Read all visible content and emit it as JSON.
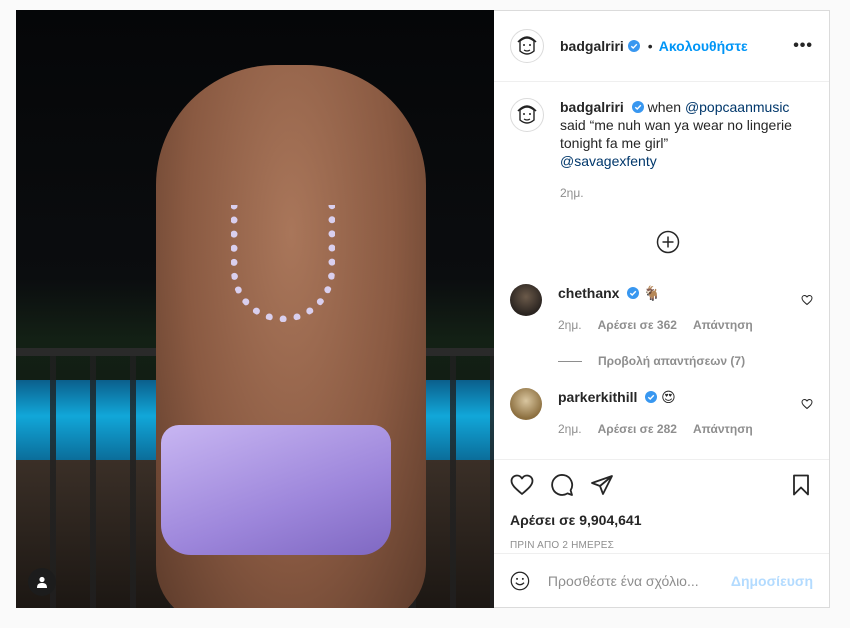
{
  "post": {
    "username": "badgalriri",
    "follow_label": "Ακολουθήστε",
    "dot": "•",
    "caption": {
      "prefix": "when ",
      "mention1": "@popcaanmusic",
      "text": " said “me nuh wan ya wear no lingerie tonight fa me girl”",
      "mention2": "@savagexfenty",
      "age": "2ημ."
    },
    "comments": [
      {
        "username": "chethanx",
        "emoji": "🐐",
        "age": "2ημ.",
        "likes": "Αρέσει σε 362",
        "reply": "Απάντηση",
        "view_replies": "Προβολή απαντήσεων (7)"
      },
      {
        "username": "parkerkithill",
        "emoji": "😍",
        "age": "2ημ.",
        "likes": "Αρέσει σε 282",
        "reply": "Απάντηση"
      }
    ],
    "likes_text": "Αρέσει σε 9,904,641",
    "timestamp": "ΠΡΙΝ ΑΠΟ 2 ΗΜΕΡΕΣ",
    "comment_placeholder": "Προσθέστε ένα σχόλιο...",
    "publish_label": "Δημοσίευση"
  },
  "icons": {
    "verified": "verified-badge-icon",
    "more": "more-options-icon",
    "like": "heart-icon",
    "comment": "comment-icon",
    "share": "paper-plane-icon",
    "save": "bookmark-icon",
    "emoji": "smiley-icon",
    "load_more": "plus-circle-icon",
    "user_tag": "user-icon"
  },
  "colors": {
    "accent": "#0095f6",
    "link": "#00376b",
    "muted": "#8e8e8e",
    "publish_disabled": "#b3dbff"
  }
}
